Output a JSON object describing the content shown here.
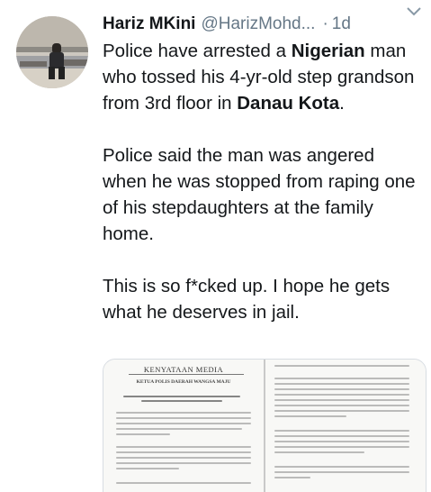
{
  "tweet": {
    "display_name": "Hariz MKini",
    "handle": "@HarizMohd...",
    "separator": "·",
    "time": "1d",
    "body": {
      "p1": [
        "Police have arrested a ",
        "Nigerian",
        " man who tossed his 4-yr-old step grandson from 3rd floor in ",
        "Danau Kota",
        "."
      ],
      "p2": "Police said the man was angered when he was stopped from raping one of his stepdaughters at the family home.",
      "p3": "This is so f*cked up. I hope he gets what he deserves in jail."
    },
    "media": {
      "left_page_title": "KENYATAAN MEDIA",
      "left_page_subtitle": "KETUA POLIS DAERAH WANGSA MAJU"
    }
  },
  "colors": {
    "text": "#14171a",
    "secondary": "#657786",
    "border": "#d8dde2"
  },
  "icons": {
    "caret": "chevron-down-icon"
  }
}
